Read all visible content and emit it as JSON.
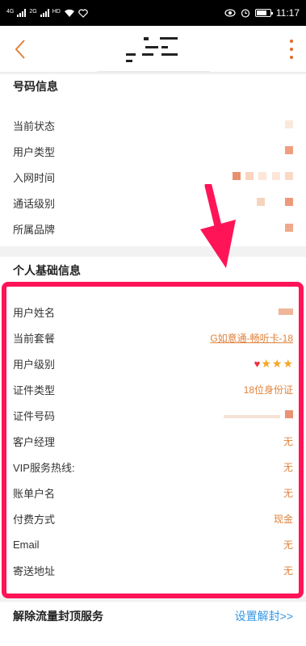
{
  "status_bar": {
    "carrier_a": "4G",
    "carrier_b": "2G",
    "signal_label": "HD",
    "time": "11:17"
  },
  "nav": {
    "back_icon": "chevron-left-icon",
    "more_icon": "more-vertical-icon"
  },
  "number_info": {
    "title": "号码信息",
    "rows": [
      {
        "label": "当前状态"
      },
      {
        "label": "用户类型"
      },
      {
        "label": "入网时间"
      },
      {
        "label": "通话级别"
      },
      {
        "label": "所属品牌"
      }
    ]
  },
  "personal_info": {
    "title": "个人基础信息",
    "rows": [
      {
        "label": "用户姓名",
        "value": ""
      },
      {
        "label": "当前套餐",
        "value": "G如意通-畅听卡-18"
      },
      {
        "label": "用户级别",
        "value": ""
      },
      {
        "label": "证件类型",
        "value": "18位身份证"
      },
      {
        "label": "证件号码",
        "value": ""
      },
      {
        "label": "客户经理",
        "value": "无"
      },
      {
        "label": "VIP服务热线:",
        "value": "无"
      },
      {
        "label": "账单户名",
        "value": "无"
      },
      {
        "label": "付费方式",
        "value": "现金"
      },
      {
        "label": "Email",
        "value": "无"
      },
      {
        "label": "寄送地址",
        "value": "无"
      }
    ],
    "user_level": {
      "hearts": 1,
      "stars": 3
    }
  },
  "bottom": {
    "title": "解除流量封顶服务",
    "link": "设置解封>>"
  },
  "colors": {
    "accent": "#e0823c",
    "highlight": "#ff1458",
    "link": "#3296e4"
  }
}
